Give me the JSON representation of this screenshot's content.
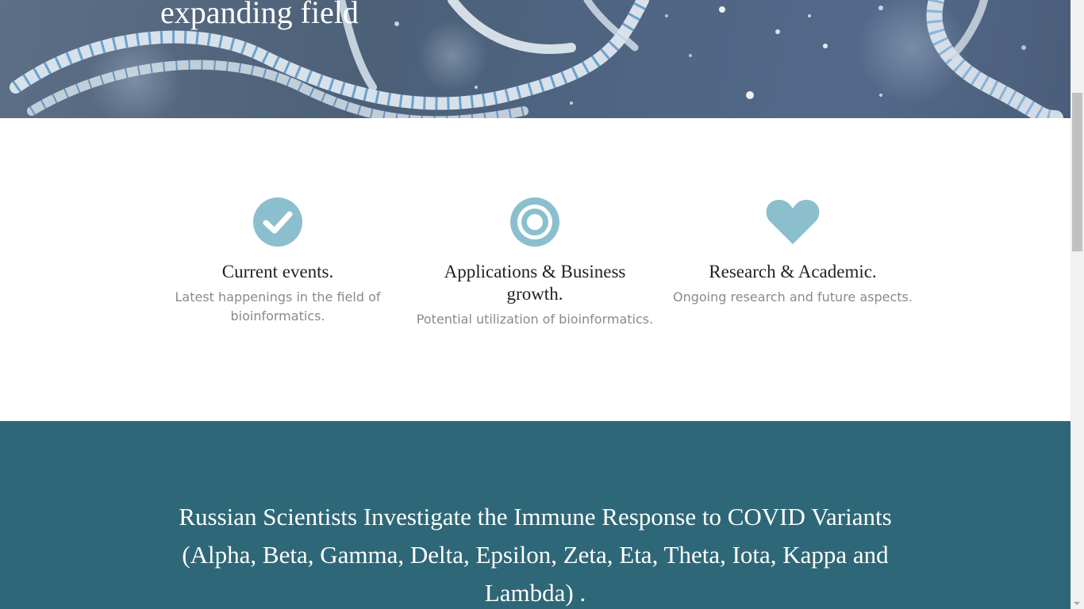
{
  "hero": {
    "title": "expanding field"
  },
  "features": [
    {
      "icon": "check-circle-icon",
      "title": "Current events.",
      "description": "Latest happenings in the field of bioinformatics."
    },
    {
      "icon": "target-icon",
      "title": "Applications & Business growth.",
      "description": "Potential utilization of bioinformatics."
    },
    {
      "icon": "heart-icon",
      "title": "Research & Academic.",
      "description": "Ongoing research and future aspects."
    }
  ],
  "news": {
    "headline": "Russian Scientists Investigate the Immune Response to COVID Variants (Alpha, Beta, Gamma, Delta, Epsilon, Zeta, Eta, Theta, Iota, Kappa and Lambda) ."
  },
  "colors": {
    "icon": "#8bbfcd",
    "news_background": "#2e6878",
    "description_text": "#8a8a8a"
  }
}
